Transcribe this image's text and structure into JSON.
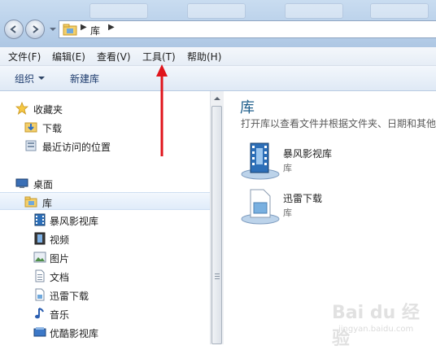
{
  "address": {
    "crumb": "库"
  },
  "menu": [
    "文件(F)",
    "编辑(E)",
    "查看(V)",
    "工具(T)",
    "帮助(H)"
  ],
  "toolbar": {
    "organize": "组织",
    "new_library": "新建库"
  },
  "nav": {
    "favorites": "收藏夹",
    "downloads": "下载",
    "recent": "最近访问的位置",
    "desktop": "桌面",
    "libraries": "库",
    "lib_children": [
      "暴风影视库",
      "视频",
      "图片",
      "文档",
      "迅雷下载",
      "音乐",
      "优酷影视库"
    ]
  },
  "content": {
    "title": "库",
    "description": "打开库以查看文件并根据文件夹、日期和其他",
    "items": [
      {
        "name": "暴风影视库",
        "type": "库"
      },
      {
        "name": "迅雷下载",
        "type": "库"
      }
    ]
  },
  "watermark": {
    "brand": "Bai du 经验",
    "url": "jingyan.baidu.com"
  },
  "colors": {
    "accent_title": "#1f5f8c",
    "annotation_arrow": "#e0141b"
  }
}
